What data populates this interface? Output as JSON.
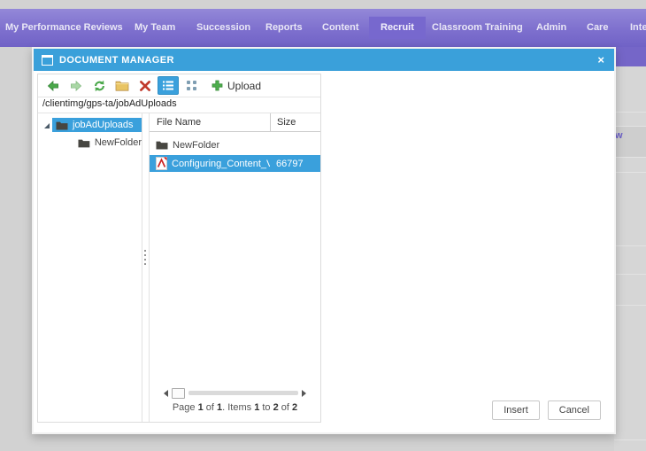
{
  "nav": {
    "items": [
      {
        "label": "My Performance Reviews",
        "active": false
      },
      {
        "label": "My Team",
        "active": false
      },
      {
        "label": "Succession",
        "active": false
      },
      {
        "label": "Reports",
        "active": false
      },
      {
        "label": "Content",
        "active": false
      },
      {
        "label": "Recruit",
        "active": true
      },
      {
        "label": "Classroom Training",
        "active": false
      },
      {
        "label": "Admin",
        "active": false
      },
      {
        "label": "Care",
        "active": false
      },
      {
        "label": "Inte",
        "active": false
      }
    ]
  },
  "dialog": {
    "title": "DOCUMENT MANAGER",
    "close_label": "×",
    "toolbar": {
      "icons": [
        "back",
        "forward",
        "refresh",
        "new-folder",
        "delete",
        "list-view",
        "thumbnails-view",
        "upload"
      ],
      "selected_view": "list-view",
      "upload_label": "Upload"
    },
    "address": "/clientimg/gps-ta/jobAdUploads",
    "tree": {
      "root_label": "jobAdUploads",
      "root_selected": true,
      "child_label": "NewFolder"
    },
    "list": {
      "columns": {
        "name": "File Name",
        "size": "Size"
      },
      "rows": [
        {
          "name": "NewFolder",
          "type": "folder",
          "size": "",
          "selected": false
        },
        {
          "name": "Configuring_Content_Vendo",
          "type": "pdf",
          "size": "66797",
          "selected": true
        }
      ],
      "pager": "Page 1 of 1. Items 1 to 2 of 2"
    },
    "buttons": {
      "insert_label": "Insert",
      "cancel_label": "Cancel"
    }
  },
  "background": {
    "partial_link_text": "w"
  },
  "colors": {
    "titlebar_blue": "#3aa0da",
    "selection_blue": "#3aa0dc",
    "nav_gradient_top": "#9388d8",
    "nav_gradient_bottom": "#7062c6",
    "nav_active_chip": "#7768ce",
    "action_green": "#4aa84a",
    "delete_red": "#c0392b",
    "folder_yellow": "#e9c463"
  }
}
